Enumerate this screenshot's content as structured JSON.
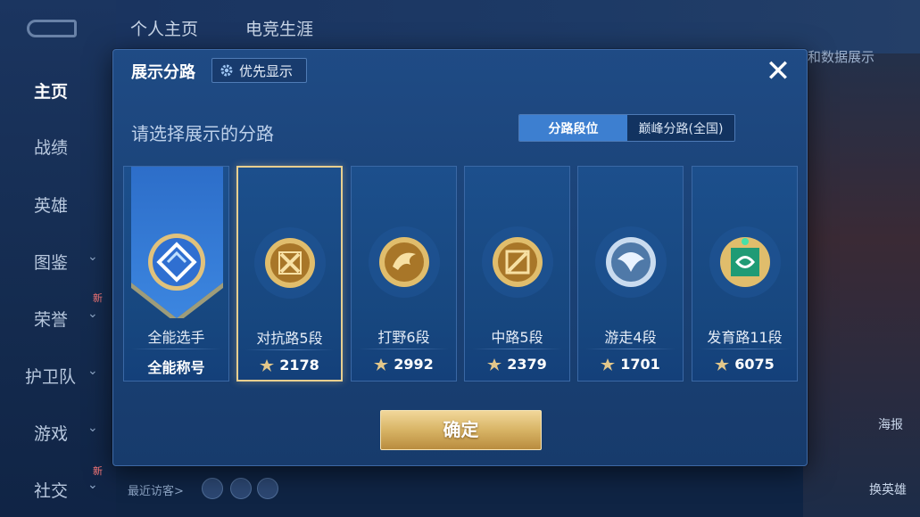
{
  "nav": {
    "items": [
      {
        "label": "主页",
        "active": true,
        "chevron": false,
        "new": false
      },
      {
        "label": "战绩",
        "active": false,
        "chevron": false,
        "new": false
      },
      {
        "label": "英雄",
        "active": false,
        "chevron": false,
        "new": false
      },
      {
        "label": "图鉴",
        "active": false,
        "chevron": true,
        "new": false
      },
      {
        "label": "荣誉",
        "active": false,
        "chevron": true,
        "new": true
      },
      {
        "label": "护卫队",
        "active": false,
        "chevron": true,
        "new": false
      },
      {
        "label": "游戏",
        "active": false,
        "chevron": true,
        "new": false
      },
      {
        "label": "社交",
        "active": false,
        "chevron": true,
        "new": true
      }
    ],
    "new_badge": "新",
    "chevron": "⌄"
  },
  "top_tabs": [
    "个人主页",
    "电竞生涯"
  ],
  "background": {
    "right_tag": "和数据展示",
    "visitors_label": "最近访客>",
    "right_labels": [
      "海报",
      "换英雄"
    ]
  },
  "modal": {
    "title": "展示分路",
    "priority_button": "优先显示",
    "close_icon": "✕",
    "subtitle": "请选择展示的分路",
    "toggle": {
      "options": [
        "分路段位",
        "巅峰分路(全国)"
      ],
      "active_index": 0
    },
    "cards": [
      {
        "name": "全能选手",
        "footer": "全能称号",
        "score": "",
        "selected": false,
        "emblem": "all-round-emblem",
        "color": "#2f6fd1"
      },
      {
        "name": "对抗路5段",
        "footer": "",
        "score": "2178",
        "selected": true,
        "emblem": "clash-lane-emblem",
        "color": "#c99a3b"
      },
      {
        "name": "打野6段",
        "footer": "",
        "score": "2992",
        "selected": false,
        "emblem": "jungle-emblem",
        "color": "#c99a3b"
      },
      {
        "name": "中路5段",
        "footer": "",
        "score": "2379",
        "selected": false,
        "emblem": "mid-lane-emblem",
        "color": "#c99a3b"
      },
      {
        "name": "游走4段",
        "footer": "",
        "score": "1701",
        "selected": false,
        "emblem": "roam-emblem",
        "color": "#9fb8d4"
      },
      {
        "name": "发育路11段",
        "footer": "",
        "score": "6075",
        "selected": false,
        "emblem": "farm-lane-emblem",
        "color": "#2bb58a"
      }
    ],
    "confirm_button": "确定"
  },
  "colors": {
    "accent_gold": "#e8cf8f",
    "toggle_active": "#3d7fd0",
    "modal_bg": "#1b4378"
  }
}
